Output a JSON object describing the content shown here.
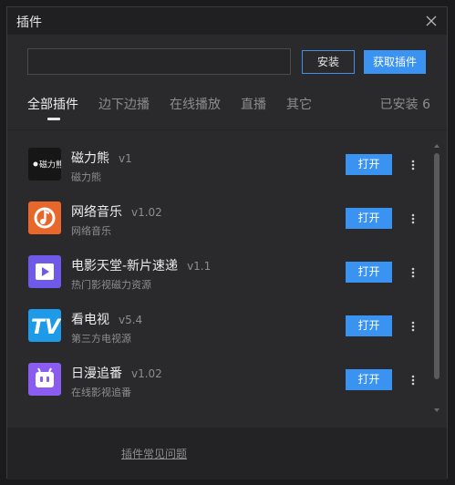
{
  "window": {
    "title": "插件"
  },
  "search": {
    "value": "",
    "placeholder": ""
  },
  "buttons": {
    "install": "安装",
    "get_plugins": "获取插件",
    "open": "打开"
  },
  "tabs": [
    {
      "label": "全部插件",
      "active": true
    },
    {
      "label": "边下边播",
      "active": false
    },
    {
      "label": "在线播放",
      "active": false
    },
    {
      "label": "直播",
      "active": false
    },
    {
      "label": "其它",
      "active": false
    }
  ],
  "installed": {
    "label": "已安装 6"
  },
  "plugins": [
    {
      "name": "磁力熊",
      "version": "v1",
      "desc": "磁力熊",
      "icon": "magnet-bear-logo-icon",
      "icon_text": "磁力熊",
      "color": "#1a1a1a"
    },
    {
      "name": "网络音乐",
      "version": "v1.02",
      "desc": "网络音乐",
      "icon": "music-note-icon",
      "color": "#e8672a"
    },
    {
      "name": "电影天堂-新片速递",
      "version": "v1.1",
      "desc": "热门影视磁力资源",
      "icon": "play-icon",
      "color": "#6f59e8"
    },
    {
      "name": "看电视",
      "version": "v5.4",
      "desc": "第三方电视源",
      "icon": "tv-icon",
      "icon_text": "TV",
      "color": "#1d9be8"
    },
    {
      "name": "日漫追番",
      "version": "v1.02",
      "desc": "在线影视追番",
      "icon": "anime-tv-icon",
      "color": "#8b5cf0"
    }
  ],
  "footer": {
    "faq": "插件常见问题"
  }
}
